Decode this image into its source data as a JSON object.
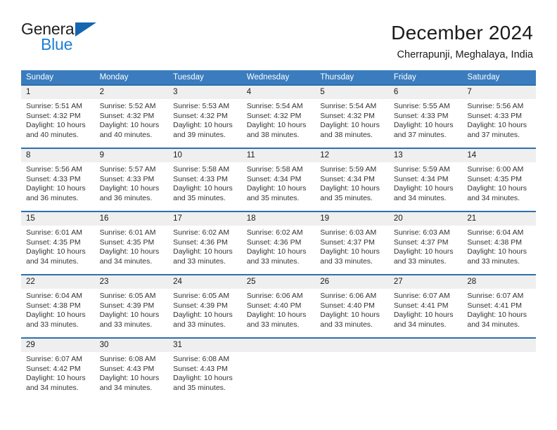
{
  "logo": {
    "word_one": "General",
    "word_two": "Blue",
    "triangle_color": "#1565b0",
    "blue_color": "#1b7fd4"
  },
  "header": {
    "title": "December 2024",
    "subtitle": "Cherrapunji, Meghalaya, India"
  },
  "theme": {
    "header_blue": "#3a7cbe",
    "row_border_blue": "#2f6fad",
    "daynum_band": "#efefef"
  },
  "calendar": {
    "weekday_headers": [
      "Sunday",
      "Monday",
      "Tuesday",
      "Wednesday",
      "Thursday",
      "Friday",
      "Saturday"
    ],
    "weeks": [
      [
        {
          "day": "1",
          "sunrise": "Sunrise: 5:51 AM",
          "sunset": "Sunset: 4:32 PM",
          "daylight_line1": "Daylight: 10 hours",
          "daylight_line2": "and 40 minutes."
        },
        {
          "day": "2",
          "sunrise": "Sunrise: 5:52 AM",
          "sunset": "Sunset: 4:32 PM",
          "daylight_line1": "Daylight: 10 hours",
          "daylight_line2": "and 40 minutes."
        },
        {
          "day": "3",
          "sunrise": "Sunrise: 5:53 AM",
          "sunset": "Sunset: 4:32 PM",
          "daylight_line1": "Daylight: 10 hours",
          "daylight_line2": "and 39 minutes."
        },
        {
          "day": "4",
          "sunrise": "Sunrise: 5:54 AM",
          "sunset": "Sunset: 4:32 PM",
          "daylight_line1": "Daylight: 10 hours",
          "daylight_line2": "and 38 minutes."
        },
        {
          "day": "5",
          "sunrise": "Sunrise: 5:54 AM",
          "sunset": "Sunset: 4:32 PM",
          "daylight_line1": "Daylight: 10 hours",
          "daylight_line2": "and 38 minutes."
        },
        {
          "day": "6",
          "sunrise": "Sunrise: 5:55 AM",
          "sunset": "Sunset: 4:33 PM",
          "daylight_line1": "Daylight: 10 hours",
          "daylight_line2": "and 37 minutes."
        },
        {
          "day": "7",
          "sunrise": "Sunrise: 5:56 AM",
          "sunset": "Sunset: 4:33 PM",
          "daylight_line1": "Daylight: 10 hours",
          "daylight_line2": "and 37 minutes."
        }
      ],
      [
        {
          "day": "8",
          "sunrise": "Sunrise: 5:56 AM",
          "sunset": "Sunset: 4:33 PM",
          "daylight_line1": "Daylight: 10 hours",
          "daylight_line2": "and 36 minutes."
        },
        {
          "day": "9",
          "sunrise": "Sunrise: 5:57 AM",
          "sunset": "Sunset: 4:33 PM",
          "daylight_line1": "Daylight: 10 hours",
          "daylight_line2": "and 36 minutes."
        },
        {
          "day": "10",
          "sunrise": "Sunrise: 5:58 AM",
          "sunset": "Sunset: 4:33 PM",
          "daylight_line1": "Daylight: 10 hours",
          "daylight_line2": "and 35 minutes."
        },
        {
          "day": "11",
          "sunrise": "Sunrise: 5:58 AM",
          "sunset": "Sunset: 4:34 PM",
          "daylight_line1": "Daylight: 10 hours",
          "daylight_line2": "and 35 minutes."
        },
        {
          "day": "12",
          "sunrise": "Sunrise: 5:59 AM",
          "sunset": "Sunset: 4:34 PM",
          "daylight_line1": "Daylight: 10 hours",
          "daylight_line2": "and 35 minutes."
        },
        {
          "day": "13",
          "sunrise": "Sunrise: 5:59 AM",
          "sunset": "Sunset: 4:34 PM",
          "daylight_line1": "Daylight: 10 hours",
          "daylight_line2": "and 34 minutes."
        },
        {
          "day": "14",
          "sunrise": "Sunrise: 6:00 AM",
          "sunset": "Sunset: 4:35 PM",
          "daylight_line1": "Daylight: 10 hours",
          "daylight_line2": "and 34 minutes."
        }
      ],
      [
        {
          "day": "15",
          "sunrise": "Sunrise: 6:01 AM",
          "sunset": "Sunset: 4:35 PM",
          "daylight_line1": "Daylight: 10 hours",
          "daylight_line2": "and 34 minutes."
        },
        {
          "day": "16",
          "sunrise": "Sunrise: 6:01 AM",
          "sunset": "Sunset: 4:35 PM",
          "daylight_line1": "Daylight: 10 hours",
          "daylight_line2": "and 34 minutes."
        },
        {
          "day": "17",
          "sunrise": "Sunrise: 6:02 AM",
          "sunset": "Sunset: 4:36 PM",
          "daylight_line1": "Daylight: 10 hours",
          "daylight_line2": "and 33 minutes."
        },
        {
          "day": "18",
          "sunrise": "Sunrise: 6:02 AM",
          "sunset": "Sunset: 4:36 PM",
          "daylight_line1": "Daylight: 10 hours",
          "daylight_line2": "and 33 minutes."
        },
        {
          "day": "19",
          "sunrise": "Sunrise: 6:03 AM",
          "sunset": "Sunset: 4:37 PM",
          "daylight_line1": "Daylight: 10 hours",
          "daylight_line2": "and 33 minutes."
        },
        {
          "day": "20",
          "sunrise": "Sunrise: 6:03 AM",
          "sunset": "Sunset: 4:37 PM",
          "daylight_line1": "Daylight: 10 hours",
          "daylight_line2": "and 33 minutes."
        },
        {
          "day": "21",
          "sunrise": "Sunrise: 6:04 AM",
          "sunset": "Sunset: 4:38 PM",
          "daylight_line1": "Daylight: 10 hours",
          "daylight_line2": "and 33 minutes."
        }
      ],
      [
        {
          "day": "22",
          "sunrise": "Sunrise: 6:04 AM",
          "sunset": "Sunset: 4:38 PM",
          "daylight_line1": "Daylight: 10 hours",
          "daylight_line2": "and 33 minutes."
        },
        {
          "day": "23",
          "sunrise": "Sunrise: 6:05 AM",
          "sunset": "Sunset: 4:39 PM",
          "daylight_line1": "Daylight: 10 hours",
          "daylight_line2": "and 33 minutes."
        },
        {
          "day": "24",
          "sunrise": "Sunrise: 6:05 AM",
          "sunset": "Sunset: 4:39 PM",
          "daylight_line1": "Daylight: 10 hours",
          "daylight_line2": "and 33 minutes."
        },
        {
          "day": "25",
          "sunrise": "Sunrise: 6:06 AM",
          "sunset": "Sunset: 4:40 PM",
          "daylight_line1": "Daylight: 10 hours",
          "daylight_line2": "and 33 minutes."
        },
        {
          "day": "26",
          "sunrise": "Sunrise: 6:06 AM",
          "sunset": "Sunset: 4:40 PM",
          "daylight_line1": "Daylight: 10 hours",
          "daylight_line2": "and 33 minutes."
        },
        {
          "day": "27",
          "sunrise": "Sunrise: 6:07 AM",
          "sunset": "Sunset: 4:41 PM",
          "daylight_line1": "Daylight: 10 hours",
          "daylight_line2": "and 34 minutes."
        },
        {
          "day": "28",
          "sunrise": "Sunrise: 6:07 AM",
          "sunset": "Sunset: 4:41 PM",
          "daylight_line1": "Daylight: 10 hours",
          "daylight_line2": "and 34 minutes."
        }
      ],
      [
        {
          "day": "29",
          "sunrise": "Sunrise: 6:07 AM",
          "sunset": "Sunset: 4:42 PM",
          "daylight_line1": "Daylight: 10 hours",
          "daylight_line2": "and 34 minutes."
        },
        {
          "day": "30",
          "sunrise": "Sunrise: 6:08 AM",
          "sunset": "Sunset: 4:43 PM",
          "daylight_line1": "Daylight: 10 hours",
          "daylight_line2": "and 34 minutes."
        },
        {
          "day": "31",
          "sunrise": "Sunrise: 6:08 AM",
          "sunset": "Sunset: 4:43 PM",
          "daylight_line1": "Daylight: 10 hours",
          "daylight_line2": "and 35 minutes."
        },
        {
          "day": "",
          "sunrise": "",
          "sunset": "",
          "daylight_line1": "",
          "daylight_line2": ""
        },
        {
          "day": "",
          "sunrise": "",
          "sunset": "",
          "daylight_line1": "",
          "daylight_line2": ""
        },
        {
          "day": "",
          "sunrise": "",
          "sunset": "",
          "daylight_line1": "",
          "daylight_line2": ""
        },
        {
          "day": "",
          "sunrise": "",
          "sunset": "",
          "daylight_line1": "",
          "daylight_line2": ""
        }
      ]
    ]
  }
}
